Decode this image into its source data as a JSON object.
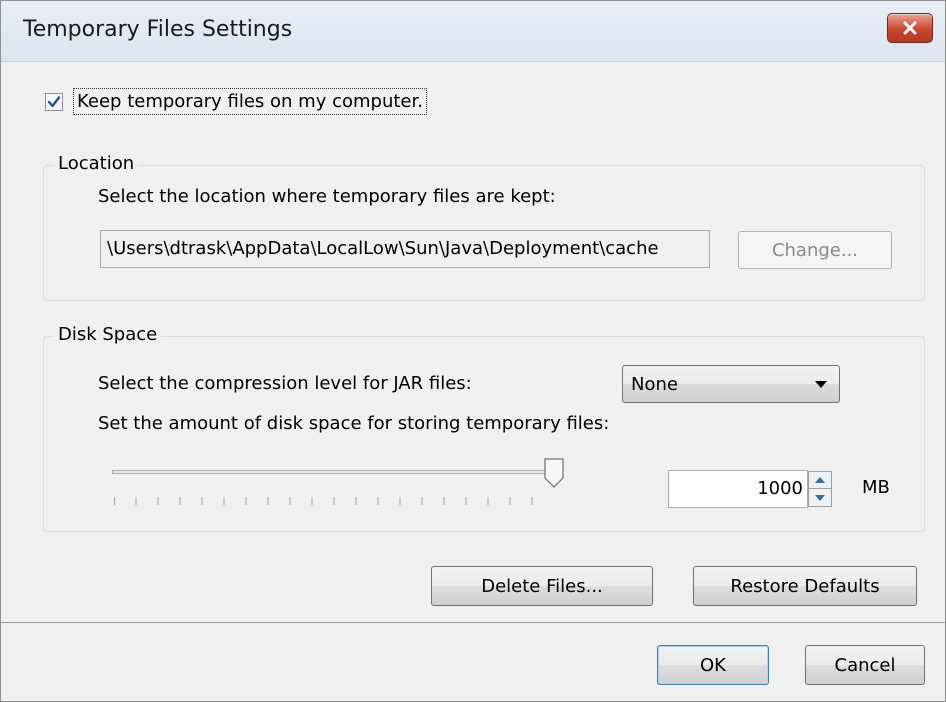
{
  "window": {
    "title": "Temporary Files Settings",
    "close_icon": "close-icon"
  },
  "keep_files": {
    "label": "Keep temporary files on my computer.",
    "checked": true
  },
  "location": {
    "legend": "Location",
    "prompt": "Select the location where temporary files are kept:",
    "path": "\\Users\\dtrask\\AppData\\LocalLow\\Sun\\Java\\Deployment\\cache",
    "change_label": "Change..."
  },
  "disk_space": {
    "legend": "Disk Space",
    "compression_prompt": "Select the compression level for JAR files:",
    "compression_value": "None",
    "space_prompt": "Set the amount of disk space for storing temporary files:",
    "slider_level": 1.0,
    "amount": "1000",
    "unit": "MB"
  },
  "actions": {
    "delete_label": "Delete Files...",
    "restore_label": "Restore Defaults"
  },
  "footer": {
    "ok_label": "OK",
    "cancel_label": "Cancel"
  },
  "colors": {
    "title_bar": "#dde5f0",
    "close_button": "#c9462c",
    "dialog_bg": "#f0f0f0",
    "accent_blue": "#3c7fb1"
  }
}
